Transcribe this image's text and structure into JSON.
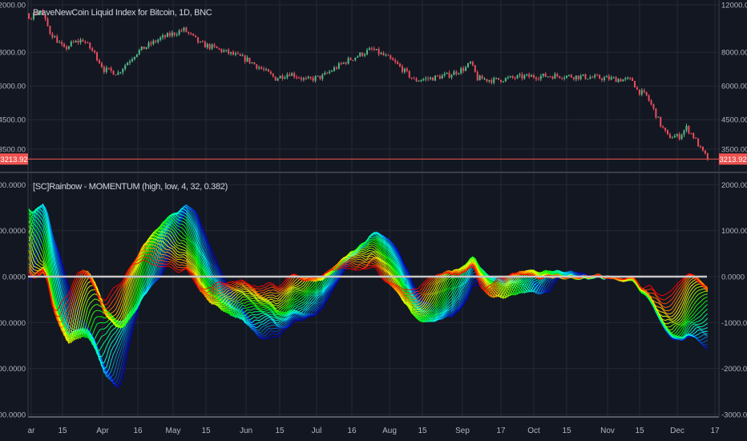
{
  "price_pane": {
    "title": "BraveNewCoin Liquid Index for Bitcoin, 1D, BNC",
    "last_price": "3213.92",
    "axis_labels": [
      "12000.00",
      "8000.00",
      "6000.00",
      "4500.00",
      "3500.00"
    ]
  },
  "indicator_pane": {
    "title": "[SC]Rainbow - MOMENTUM (high, low, 4, 32, 0.382)",
    "axis_labels": [
      "2000.0000",
      "1000.0000",
      "0.0000",
      "-1000.0000",
      "-2000.0000",
      "-3000.0000"
    ]
  },
  "time_axis": {
    "labels": [
      "ar",
      "15",
      "Apr",
      "16",
      "May",
      "15",
      "Jun",
      "15",
      "Jul",
      "16",
      "Aug",
      "15",
      "Sep",
      "17",
      "Oct",
      "15",
      "Nov",
      "15",
      "Dec",
      "17"
    ]
  },
  "colors": {
    "background": "#131722",
    "grid": "#242833",
    "up": "#53b987",
    "down": "#eb4d5c",
    "last_price": "#ef5350",
    "zero_line": "#c8c8c8"
  },
  "chart_data": [
    {
      "type": "candlestick",
      "title": "BraveNewCoin Liquid Index for Bitcoin, 1D, BNC",
      "scale": "log",
      "ylim": [
        3100,
        12500
      ],
      "x_unit": "days since Mar 1",
      "price_keypoints": [
        [
          -35,
          11500
        ],
        [
          -25,
          8000
        ],
        [
          -20,
          8500
        ],
        [
          -10,
          11000
        ],
        [
          0,
          10900
        ],
        [
          4,
          11400
        ],
        [
          8,
          9500
        ],
        [
          14,
          8200
        ],
        [
          17,
          8600
        ],
        [
          22,
          8900
        ],
        [
          27,
          7900
        ],
        [
          31,
          6900
        ],
        [
          37,
          6700
        ],
        [
          45,
          8000
        ],
        [
          55,
          9000
        ],
        [
          65,
          9700
        ],
        [
          72,
          8600
        ],
        [
          78,
          8300
        ],
        [
          92,
          7500
        ],
        [
          104,
          6400
        ],
        [
          110,
          6700
        ],
        [
          117,
          6300
        ],
        [
          124,
          6500
        ],
        [
          134,
          7400
        ],
        [
          145,
          8200
        ],
        [
          151,
          7700
        ],
        [
          155,
          7300
        ],
        [
          163,
          6300
        ],
        [
          170,
          6400
        ],
        [
          178,
          6600
        ],
        [
          185,
          7000
        ],
        [
          187,
          7300
        ],
        [
          190,
          6400
        ],
        [
          197,
          6300
        ],
        [
          210,
          6500
        ],
        [
          225,
          6550
        ],
        [
          240,
          6450
        ],
        [
          256,
          6300
        ],
        [
          258,
          5800
        ],
        [
          262,
          5500
        ],
        [
          268,
          4300
        ],
        [
          271,
          3900
        ],
        [
          276,
          3900
        ],
        [
          279,
          4200
        ],
        [
          282,
          3900
        ],
        [
          285,
          3500
        ],
        [
          288,
          3213.92
        ]
      ],
      "last_value": 3213.92
    },
    {
      "type": "line",
      "title": "[SC]Rainbow - MOMENTUM",
      "source": [
        "high",
        "low"
      ],
      "min_length": 4,
      "max_length": 32,
      "factor": 0.382,
      "ylim": [
        -3000,
        2000
      ],
      "zero_line": 0
    }
  ]
}
